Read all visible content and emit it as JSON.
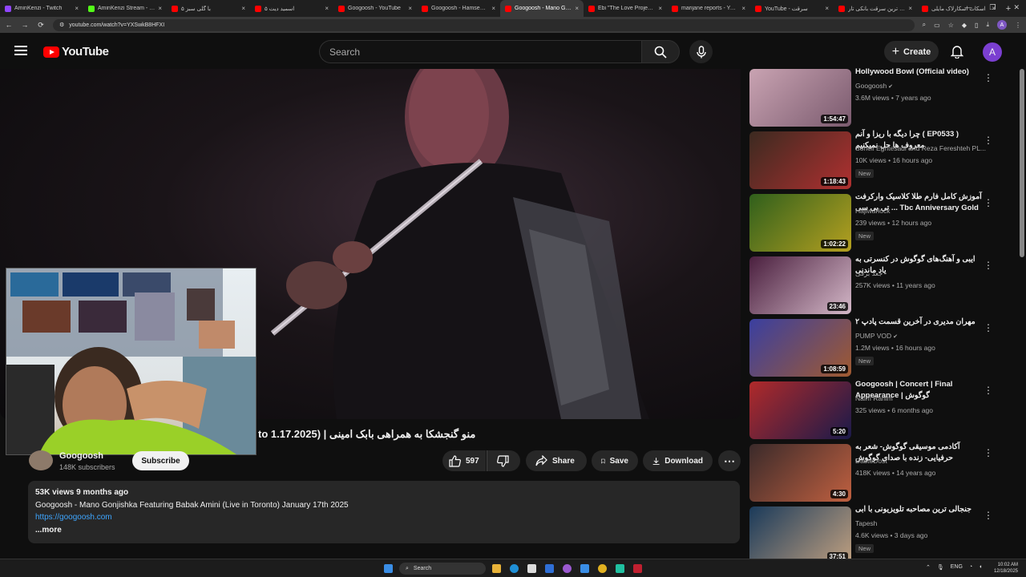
{
  "browser": {
    "tabs": [
      {
        "title": "AminKenzi - Twitch",
        "color": "#9146ff",
        "active": false
      },
      {
        "title": "AminKenzi Stream - Work",
        "color": "#53fc18",
        "active": false
      },
      {
        "title": "با گلی سبز ۵",
        "color": "#ff0000",
        "active": false
      },
      {
        "title": "اسمید دیت ۵",
        "color": "#ff0000",
        "active": false
      },
      {
        "title": "Googoosh - YouTube",
        "color": "#ff0000",
        "active": false
      },
      {
        "title": "Googoosh - Hamseda (Li",
        "color": "#ff0000",
        "active": false
      },
      {
        "title": "Googoosh - Mano Gonjis",
        "color": "#ff0000",
        "active": true
      },
      {
        "title": "Ebi \"The Love Project\" Liv",
        "color": "#ff0000",
        "active": false
      },
      {
        "title": "marijane reports - YouTub",
        "color": "#ff0000",
        "active": false
      },
      {
        "title": "YouTube - سرقت",
        "color": "#ff0000",
        "active": false
      },
      {
        "title": "عجیب ترین سرقت بانکی تار",
        "color": "#ff0000",
        "active": false
      },
      {
        "title": "اسکات اسکارلاک مایلی",
        "color": "#ff0000",
        "active": false
      }
    ],
    "tab_close": "×",
    "new_tab": "+",
    "window_controls": [
      "—",
      "❐",
      "✕"
    ],
    "url": "youtube.com/watch?v=YXSwkB8HFXI",
    "nav": {
      "back": "←",
      "forward": "→",
      "reload": "⟳"
    },
    "profile_letter": "A"
  },
  "header": {
    "logo_text": "YouTube",
    "search_placeholder": "Search",
    "create_label": "Create",
    "avatar_letter": "A"
  },
  "video": {
    "title": "منو گنجشکا به همراهی بابک امینی | (Live in Toronto 1.17.2025)",
    "title_visible": "to 1.17.2025) | منو گنجشکا به همراهی بابک امینی",
    "channel": "Googoosh",
    "subscribers": "148K subscribers",
    "subscribe_label": "Subscribe",
    "likes": "597",
    "share_label": "Share",
    "save_label": "Save",
    "download_label": "Download",
    "more_actions": "⋯",
    "description": {
      "meta": "53K views  9 months ago",
      "line": "Googoosh - Mano Gonjishka Featuring Babak Amini (Live in Toronto) January 17th 2025",
      "link": "https://googoosh.com",
      "more": "...more"
    }
  },
  "recommendations": [
    {
      "title": "Hollywood Bowl (Official video)",
      "channel": "Googoosh",
      "verified": true,
      "stats": "3.6M views • 7 years ago",
      "duration": "1:54:47",
      "new": false,
      "thumb": [
        "#c9a3b2",
        "#7a5a6e"
      ]
    },
    {
      "title": "چرا دیگه با ریزا و آنم ( EP0533 ) معروف ها حل نمیکنیم",
      "channel": "Soheil Eghtesadi and Reza Fereshteh PL...",
      "verified": false,
      "stats": "10K views • 16 hours ago",
      "duration": "1:18:43",
      "new": true,
      "thumb": [
        "#3b2a20",
        "#b03030"
      ]
    },
    {
      "title": "آموزش کامل فارم طلا کلاسیک وارکرفت تی بی سی ... Tbc Anniversary Gold",
      "channel": "Hajiwarlock",
      "verified": false,
      "stats": "239 views • 12 hours ago",
      "duration": "1:02:22",
      "new": true,
      "thumb": [
        "#2f5f1c",
        "#b5a020"
      ]
    },
    {
      "title": "ایبی و آهنگ‌های گوگوش در کنسرتی به یاد ماندنی",
      "channel": "جعد برقی",
      "verified": false,
      "stats": "257K views • 11 years ago",
      "duration": "23:46",
      "new": false,
      "thumb": [
        "#4a1f3e",
        "#d4b8c8"
      ]
    },
    {
      "title": "مهران مدیری در آخرین قسمت پادپ ۲",
      "channel": "PUMP VOD",
      "verified": true,
      "stats": "1.2M views • 16 hours ago",
      "duration": "1:08:59",
      "new": true,
      "thumb": [
        "#3a3fa0",
        "#a05a30"
      ]
    },
    {
      "title": "Googoosh | Concert | Final Appearance | گوگوش",
      "channel": "Naim Rahim",
      "verified": false,
      "stats": "325 views • 6 months ago",
      "duration": "5:20",
      "new": false,
      "thumb": [
        "#b02a2a",
        "#1a1a4a"
      ]
    },
    {
      "title": "آکادمی موسیقی گوگوش- شعر به حرفیایی- زنده با صدای گوگوش",
      "channel": "DasteDost",
      "verified": false,
      "stats": "418K views • 14 years ago",
      "duration": "4:30",
      "new": false,
      "thumb": [
        "#3a2a2a",
        "#c06040"
      ]
    },
    {
      "title": "جنجالی ترین مصاحبه تلویزیونی با ابی",
      "channel": "Tapesh",
      "verified": false,
      "stats": "4.6K views • 3 days ago",
      "duration": "37:51",
      "new": true,
      "thumb": [
        "#1a3a5a",
        "#c0a080"
      ]
    }
  ],
  "new_badge": "New",
  "taskbar": {
    "search_label": "Search",
    "lang": "ENG",
    "time": "10:02 AM",
    "date": "12/18/2025"
  }
}
